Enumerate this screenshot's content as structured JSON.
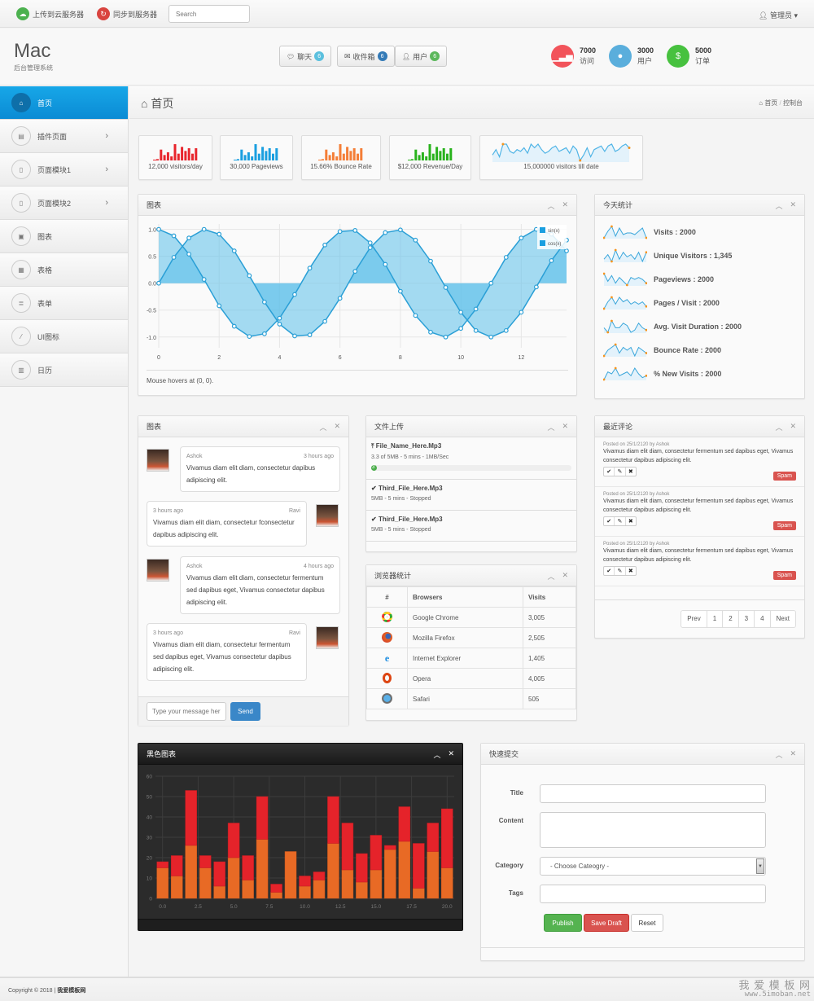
{
  "topbar": {
    "upload_label": "上传到云服务器",
    "sync_label": "同步到服务器",
    "search_placeholder": "Search",
    "user_label": "管理员"
  },
  "header": {
    "logo": "Mac",
    "subtitle": "后台管理系统",
    "buttons": [
      {
        "label": "聊天",
        "badge": "6",
        "icon": "comments-icon",
        "color": "#5bc0de"
      },
      {
        "label": "收件箱",
        "badge": "6",
        "icon": "envelope-icon",
        "color": "#337ab7"
      },
      {
        "label": "用户",
        "badge": "6",
        "icon": "user-icon",
        "color": "#5cb85c"
      }
    ],
    "stats": [
      {
        "value": "7000",
        "label": "访问",
        "icon": "signal-icon",
        "color": "#f2545b"
      },
      {
        "value": "3000",
        "label": "用户",
        "icon": "user-icon",
        "color": "#5aaedc"
      },
      {
        "value": "5000",
        "label": "订单",
        "icon": "money-icon",
        "color": "#47c13f"
      }
    ]
  },
  "sidebar": {
    "items": [
      {
        "label": "首页",
        "icon": "home-icon",
        "active": true
      },
      {
        "label": "插件页面",
        "icon": "window-icon",
        "chevron": true
      },
      {
        "label": "页面模块1",
        "icon": "file-icon",
        "chevron": true
      },
      {
        "label": "页面模块2",
        "icon": "file-icon",
        "chevron": true
      },
      {
        "label": "图表",
        "icon": "picture-icon"
      },
      {
        "label": "表格",
        "icon": "table-icon"
      },
      {
        "label": "表单",
        "icon": "form-icon"
      },
      {
        "label": "UI图标",
        "icon": "magic-wand-icon"
      },
      {
        "label": "日历",
        "icon": "calendar-icon"
      }
    ]
  },
  "page": {
    "title": "首页",
    "breadcrumb": [
      "首页",
      "控制台"
    ]
  },
  "mini_stats": [
    {
      "label": "12,000 visitors/day",
      "color": "#e8262d",
      "values": [
        1,
        8,
        4,
        6,
        3,
        12,
        5,
        10,
        7,
        9,
        5,
        9
      ]
    },
    {
      "label": "30,000 Pageviews",
      "color": "#1a9fe0",
      "values": [
        1,
        8,
        4,
        6,
        3,
        12,
        5,
        10,
        7,
        9,
        5,
        9
      ]
    },
    {
      "label": "15.66% Bounce Rate",
      "color": "#f47e37",
      "values": [
        1,
        8,
        4,
        6,
        3,
        12,
        5,
        10,
        7,
        9,
        5,
        9
      ]
    },
    {
      "label": "$12,000 Revenue/Day",
      "color": "#28b21c",
      "values": [
        1,
        8,
        4,
        6,
        3,
        12,
        5,
        10,
        7,
        9,
        5,
        9
      ]
    },
    {
      "label": "15,000000 visitors till date",
      "color": "#4fb4e6",
      "values": [
        4,
        7,
        3,
        10,
        10,
        6,
        5,
        7,
        6,
        8,
        5,
        10,
        8,
        10,
        7,
        5,
        6,
        8,
        9,
        6,
        7,
        8,
        5,
        9,
        7,
        1,
        4,
        8,
        3,
        7,
        8,
        9,
        6,
        9,
        10,
        6,
        7,
        9,
        10,
        8
      ]
    }
  ],
  "sine_chart": {
    "title": "图表",
    "hover_text": "Mouse hovers at (0, 0).",
    "chart_data": {
      "type": "area",
      "x": [
        0,
        0.5,
        1,
        1.5,
        2,
        2.5,
        3,
        3.5,
        4,
        4.5,
        5,
        5.5,
        6,
        6.5,
        7,
        7.5,
        8,
        8.5,
        9,
        9.5,
        10,
        10.5,
        11,
        11.5,
        12,
        12.5,
        13,
        13.5
      ],
      "series": [
        {
          "name": "sin(x)",
          "values": [
            0,
            0.48,
            0.84,
            1.0,
            0.91,
            0.6,
            0.14,
            -0.35,
            -0.76,
            -0.98,
            -0.96,
            -0.71,
            -0.28,
            0.22,
            0.66,
            0.94,
            0.99,
            0.8,
            0.41,
            -0.08,
            -0.54,
            -0.88,
            -1.0,
            -0.88,
            -0.54,
            -0.07,
            0.42,
            0.8
          ]
        },
        {
          "name": "cos(x)",
          "values": [
            1.0,
            0.88,
            0.54,
            0.07,
            -0.42,
            -0.8,
            -0.99,
            -0.94,
            -0.65,
            -0.21,
            0.28,
            0.71,
            0.96,
            0.98,
            0.75,
            0.35,
            -0.15,
            -0.6,
            -0.91,
            -1.0,
            -0.84,
            -0.48,
            0.0,
            0.48,
            0.84,
            1.0,
            0.91,
            0.6
          ]
        }
      ],
      "xticks": [
        "0",
        "2",
        "4",
        "6",
        "8",
        "10",
        "12"
      ],
      "yticks": [
        "1.0",
        "0.5",
        "0.0",
        "-0.5",
        "-1.0"
      ],
      "ylim": [
        -1.2,
        1.1
      ],
      "xlim": [
        0,
        13.5
      ],
      "legend": "top-right"
    }
  },
  "today_stats": {
    "title": "今天统计",
    "items": [
      {
        "label": "Visits : 2000",
        "values": [
          2,
          6,
          9,
          3,
          8,
          4,
          5,
          5,
          4,
          6,
          8,
          2
        ]
      },
      {
        "label": "Unique Visitors : 1,345",
        "values": [
          4,
          6,
          3,
          8,
          4,
          7,
          5,
          6,
          4,
          7,
          3,
          7
        ]
      },
      {
        "label": "Pageviews : 2000",
        "values": [
          8,
          4,
          7,
          3,
          6,
          4,
          2,
          6,
          5,
          6,
          5,
          3
        ]
      },
      {
        "label": "Pages / Visit : 2000",
        "values": [
          3,
          6,
          8,
          5,
          8,
          6,
          7,
          5,
          6,
          5,
          6,
          4
        ]
      },
      {
        "label": "Avg. Visit Duration : 2000",
        "values": [
          5,
          3,
          8,
          5,
          5,
          7,
          6,
          3,
          4,
          7,
          5,
          4
        ]
      },
      {
        "label": "Bounce Rate : 2000",
        "values": [
          3,
          5,
          6,
          7,
          4,
          6,
          5,
          6,
          3,
          6,
          5,
          4
        ]
      },
      {
        "label": "% New Visits : 2000",
        "values": [
          2,
          6,
          5,
          8,
          4,
          5,
          6,
          4,
          8,
          5,
          3,
          4
        ]
      }
    ]
  },
  "chat": {
    "title": "图表",
    "messages": [
      {
        "name": "Ashok",
        "time": "3 hours ago",
        "text": "Vivamus diam elit diam, consectetur dapibus adipiscing elit.",
        "side": "left"
      },
      {
        "name": "Ravi",
        "time": "3 hours ago",
        "text": "Vivamus diam elit diam, consectetur fconsectetur dapibus adipiscing elit.",
        "side": "right"
      },
      {
        "name": "Ashok",
        "time": "4 hours ago",
        "text": "Vivamus diam elit diam, consectetur fermentum sed dapibus eget, Vivamus consectetur dapibus adipiscing elit.",
        "side": "left"
      },
      {
        "name": "Ravi",
        "time": "3 hours ago",
        "text": "Vivamus diam elit diam, consectetur fermentum sed dapibus eget, Vivamus consectetur dapibus adipiscing elit.",
        "side": "right"
      }
    ],
    "input_placeholder": "Type your message here",
    "send_label": "Send"
  },
  "upload": {
    "title": "文件上传",
    "files": [
      {
        "name": "File_Name_Here.Mp3",
        "status": "3.3 of 5MB - 5 mins - 1MB/Sec",
        "progress_percent": 3,
        "progress_label": "3",
        "uploading": true
      },
      {
        "name": "Third_File_Here.Mp3",
        "status": "5MB - 5 mins - Stopped"
      },
      {
        "name": "Third_File_Here.Mp3",
        "status": "5MB - 5 mins - Stopped"
      }
    ]
  },
  "browsers": {
    "title": "浏览器统计",
    "columns": [
      "#",
      "Browsers",
      "Visits"
    ],
    "rows": [
      {
        "icon": "chrome-icon",
        "name": "Google Chrome",
        "visits": "3,005"
      },
      {
        "icon": "firefox-icon",
        "name": "Mozilla Firefox",
        "visits": "2,505"
      },
      {
        "icon": "ie-icon",
        "name": "Internet Explorer",
        "visits": "1,405"
      },
      {
        "icon": "opera-icon",
        "name": "Opera",
        "visits": "4,005"
      },
      {
        "icon": "safari-icon",
        "name": "Safari",
        "visits": "505"
      }
    ]
  },
  "comments": {
    "title": "最近评论",
    "items": [
      {
        "meta": "Posted on 25/1/2120 by Ashok",
        "text": "Vivamus diam elit diam, consectetur fermentum sed dapibus eget, Vivamus consectetur dapibus adipiscing elit.",
        "spam_label": "Spam"
      },
      {
        "meta": "Posted on 25/1/2120 by Ashok",
        "text": "Vivamus diam elit diam, consectetur fermentum sed dapibus eget, Vivamus consectetur dapibus adipiscing elit.",
        "spam_label": "Spam"
      },
      {
        "meta": "Posted on 25/1/2120 by Ashok",
        "text": "Vivamus diam elit diam, consectetur fermentum sed dapibus eget, Vivamus consectetur dapibus adipiscing elit.",
        "spam_label": "Spam"
      }
    ],
    "pager": [
      "Prev",
      "1",
      "2",
      "3",
      "4",
      "Next"
    ]
  },
  "dark_chart": {
    "title": "黑色图表",
    "chart_data": {
      "type": "bar",
      "stacked": true,
      "x": [
        0,
        1,
        2,
        3,
        4,
        5,
        6,
        7,
        8,
        9,
        10,
        11,
        12,
        13,
        14,
        15,
        16,
        17,
        18,
        19,
        20
      ],
      "series": [
        {
          "name": "bottom",
          "color": "#e86a25",
          "values": [
            15,
            11,
            26,
            15,
            6,
            20,
            9,
            29,
            3,
            23,
            6,
            9,
            27,
            14,
            8,
            14,
            24,
            28,
            5,
            23,
            15
          ]
        },
        {
          "name": "top",
          "color": "#e5232a",
          "values": [
            3,
            10,
            27,
            6,
            12,
            17,
            12,
            21,
            4,
            0,
            5,
            4,
            23,
            23,
            14,
            17,
            2,
            17,
            22,
            14,
            29
          ]
        }
      ],
      "xticks": [
        "0.0",
        "2.5",
        "5.0",
        "7.5",
        "10.0",
        "12.5",
        "15.0",
        "17.5",
        "20.0"
      ],
      "yticks": [
        "0",
        "10",
        "20",
        "30",
        "40",
        "50",
        "60"
      ],
      "ylim": [
        0,
        60
      ],
      "xlim": [
        -0.5,
        20.5
      ]
    }
  },
  "quick_post": {
    "title": "快速提交",
    "fields": {
      "title_label": "Title",
      "content_label": "Content",
      "category_label": "Category",
      "category_value": "- Choose Cateogry -",
      "tags_label": "Tags"
    },
    "publish_label": "Publish",
    "save_draft_label": "Save Draft",
    "reset_label": "Reset"
  },
  "footer": {
    "copyright": "Copyright © 2018 |",
    "link": "我爱模板网",
    "watermark_cn": "我 爱 模 板 网",
    "watermark_url": "www.5imoban.net"
  }
}
